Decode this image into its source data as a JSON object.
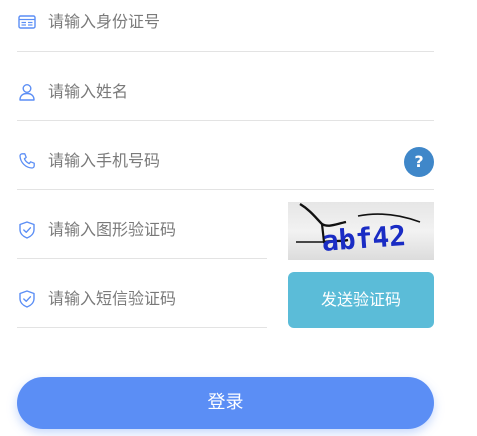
{
  "form": {
    "id_field": {
      "placeholder": "请输入身份证号",
      "icon": "id-card-icon"
    },
    "name_field": {
      "placeholder": "请输入姓名",
      "icon": "user-icon"
    },
    "phone_field": {
      "placeholder": "请输入手机号码",
      "icon": "phone-icon"
    },
    "captcha_field": {
      "placeholder": "请输入图形验证码",
      "icon": "shield-check-icon"
    },
    "sms_field": {
      "placeholder": "请输入短信验证码",
      "icon": "shield-check-icon"
    }
  },
  "help": {
    "label": "?"
  },
  "captcha": {
    "text": "abf42"
  },
  "sms_button": {
    "label": "发送验证码"
  },
  "login_button": {
    "label": "登录"
  },
  "colors": {
    "accent": "#5b8ef5",
    "sms_button": "#5bbcd8",
    "help_button": "#3f87c9",
    "icon": "#5b8ef5",
    "captcha_text": "#1a2cc4"
  }
}
